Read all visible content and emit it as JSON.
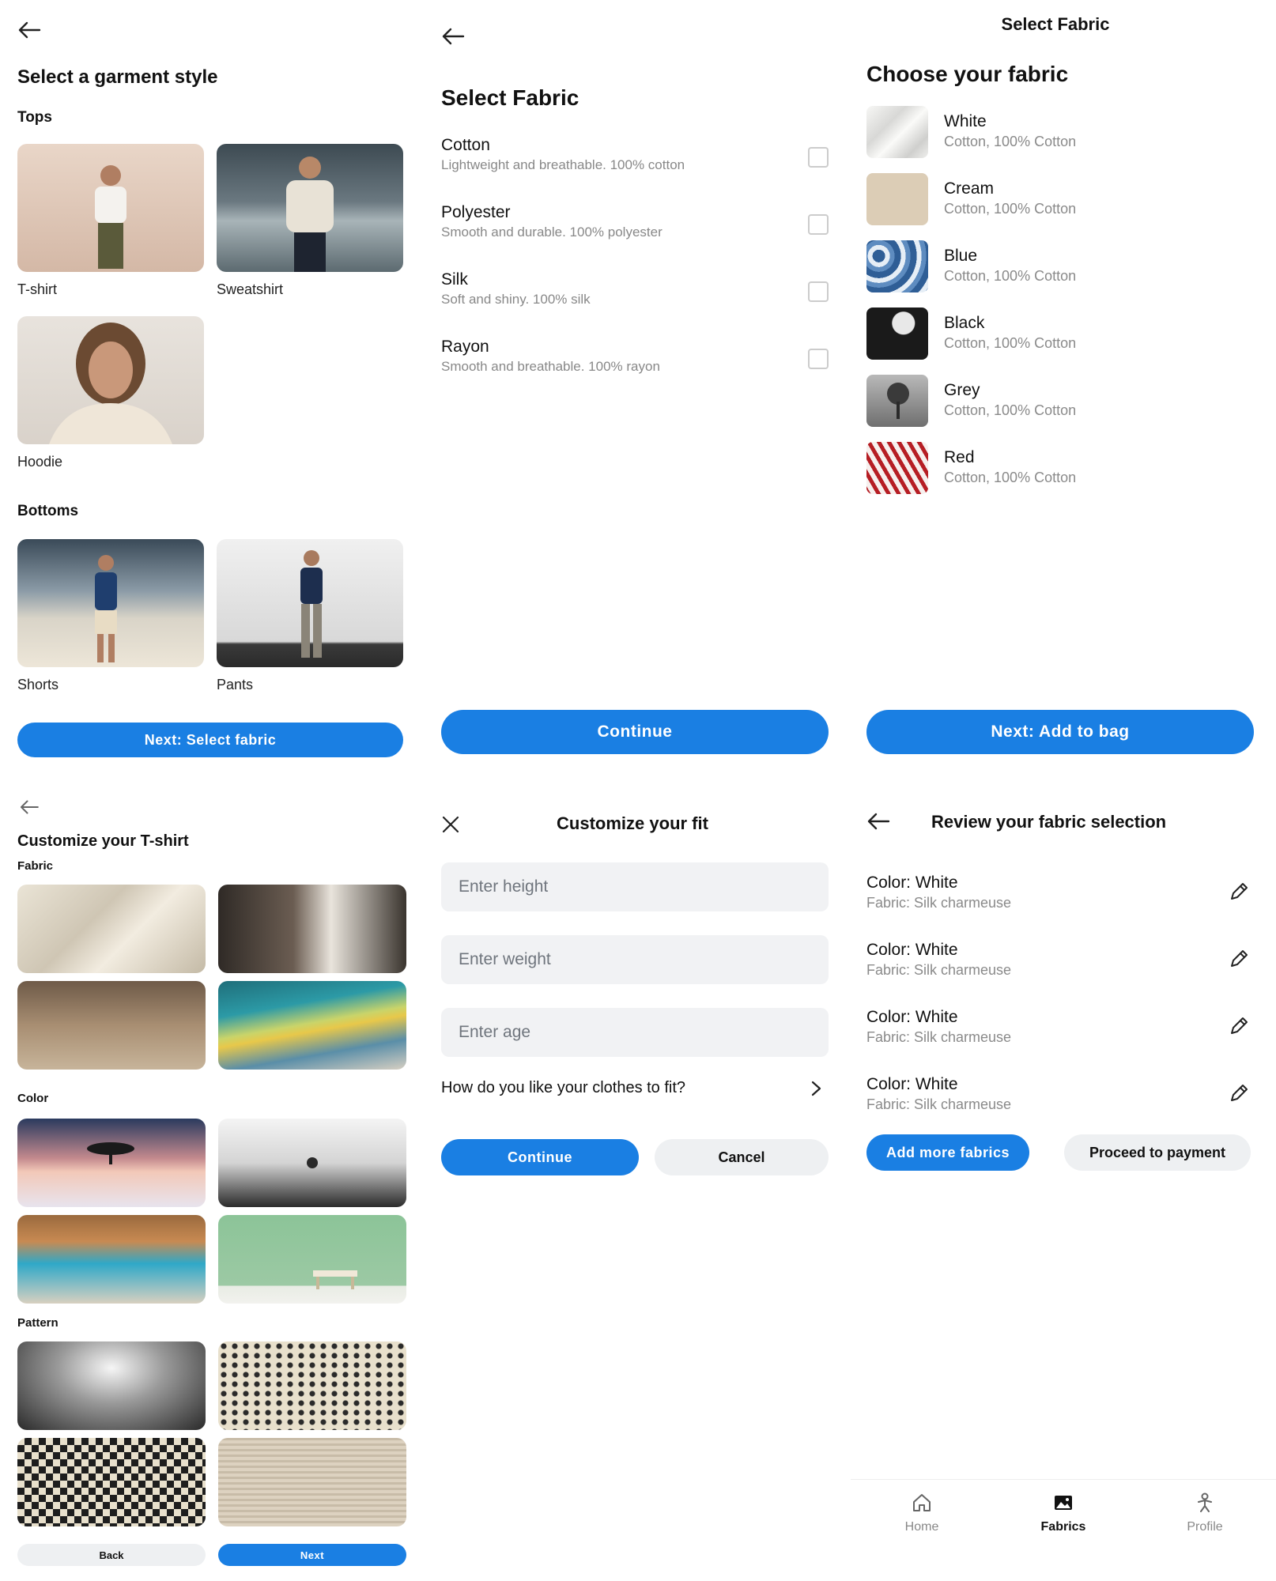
{
  "panel1": {
    "title": "Select a garment style",
    "tops_heading": "Tops",
    "tops": [
      {
        "label": "T-shirt"
      },
      {
        "label": "Sweatshirt"
      },
      {
        "label": "Hoodie"
      }
    ],
    "bottoms_heading": "Bottoms",
    "bottoms": [
      {
        "label": "Shorts"
      },
      {
        "label": "Pants"
      }
    ],
    "next_button": "Next: Select fabric"
  },
  "panel2": {
    "title": "Select Fabric",
    "options": [
      {
        "name": "Cotton",
        "desc": "Lightweight and breathable. 100% cotton"
      },
      {
        "name": "Polyester",
        "desc": "Smooth and durable. 100% polyester"
      },
      {
        "name": "Silk",
        "desc": "Soft and shiny. 100% silk"
      },
      {
        "name": "Rayon",
        "desc": "Smooth and breathable. 100% rayon"
      }
    ],
    "continue_button": "Continue"
  },
  "panel3": {
    "header": "Select Fabric",
    "title": "Choose your fabric",
    "swatches": [
      {
        "name": "White",
        "desc": "Cotton, 100% Cotton"
      },
      {
        "name": "Cream",
        "desc": "Cotton, 100% Cotton"
      },
      {
        "name": "Blue",
        "desc": "Cotton, 100% Cotton"
      },
      {
        "name": "Black",
        "desc": "Cotton, 100% Cotton"
      },
      {
        "name": "Grey",
        "desc": "Cotton, 100% Cotton"
      },
      {
        "name": "Red",
        "desc": "Cotton, 100% Cotton"
      }
    ],
    "next_button": "Next: Add to bag"
  },
  "panel4": {
    "title": "Customize your T-shirt",
    "fabric_heading": "Fabric",
    "color_heading": "Color",
    "pattern_heading": "Pattern",
    "back_button": "Back",
    "next_button": "Next"
  },
  "panel5": {
    "title": "Customize your fit",
    "height_placeholder": "Enter height",
    "weight_placeholder": "Enter weight",
    "age_placeholder": "Enter age",
    "fit_question": "How do you like your clothes to fit?",
    "continue_button": "Continue",
    "cancel_button": "Cancel"
  },
  "panel6": {
    "title": "Review your fabric selection",
    "items": [
      {
        "color": "Color: White",
        "fabric": "Fabric: Silk charmeuse"
      },
      {
        "color": "Color: White",
        "fabric": "Fabric: Silk charmeuse"
      },
      {
        "color": "Color: White",
        "fabric": "Fabric: Silk charmeuse"
      },
      {
        "color": "Color: White",
        "fabric": "Fabric: Silk charmeuse"
      }
    ],
    "add_button": "Add more fabrics",
    "proceed_button": "Proceed to payment",
    "tabs": [
      {
        "label": "Home",
        "icon": "home-icon"
      },
      {
        "label": "Fabrics",
        "icon": "image-icon"
      },
      {
        "label": "Profile",
        "icon": "person-icon"
      }
    ]
  },
  "colors": {
    "accent": "#1a7fe3",
    "muted_text": "#8a8a8a",
    "field_bg": "#f1f2f4"
  }
}
